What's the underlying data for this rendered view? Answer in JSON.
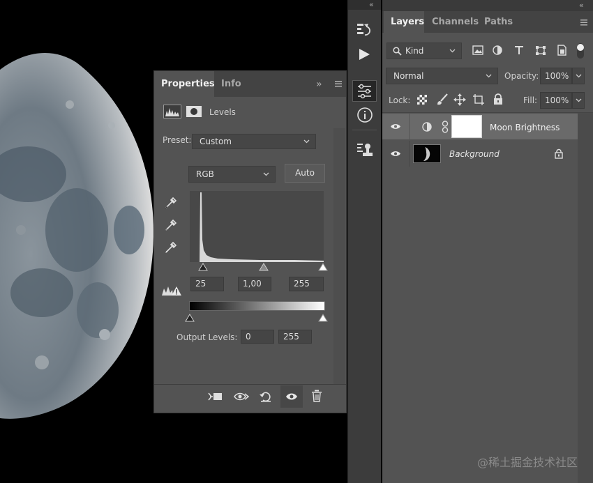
{
  "collapse_arrows": "«",
  "properties": {
    "tabs": [
      "Properties",
      "Info"
    ],
    "expand_glyph": "»",
    "adjustment_title": "Levels",
    "preset_label": "Preset:",
    "preset_value": "Custom",
    "channel_value": "RGB",
    "auto_label": "Auto",
    "input_black": "25",
    "input_gamma": "1,00",
    "input_white": "255",
    "output_label": "Output Levels:",
    "output_black": "0",
    "output_white": "255"
  },
  "layers_panel": {
    "tabs": [
      "Layers",
      "Channels",
      "Paths"
    ],
    "filter_value": "Kind",
    "blend_mode": "Normal",
    "opacity_label": "Opacity:",
    "opacity_value": "100%",
    "lock_label": "Lock:",
    "fill_label": "Fill:",
    "fill_value": "100%",
    "layers": [
      {
        "name": "Moon Brightness",
        "visible": true,
        "selected": true
      },
      {
        "name": "Background",
        "visible": true,
        "locked": true
      }
    ]
  },
  "watermark": "@稀土掘金技术社区",
  "colors": {
    "panel": "#535353",
    "panel_dark": "#434343",
    "canvas": "#000000",
    "selected_row": "#6a6a6a"
  }
}
